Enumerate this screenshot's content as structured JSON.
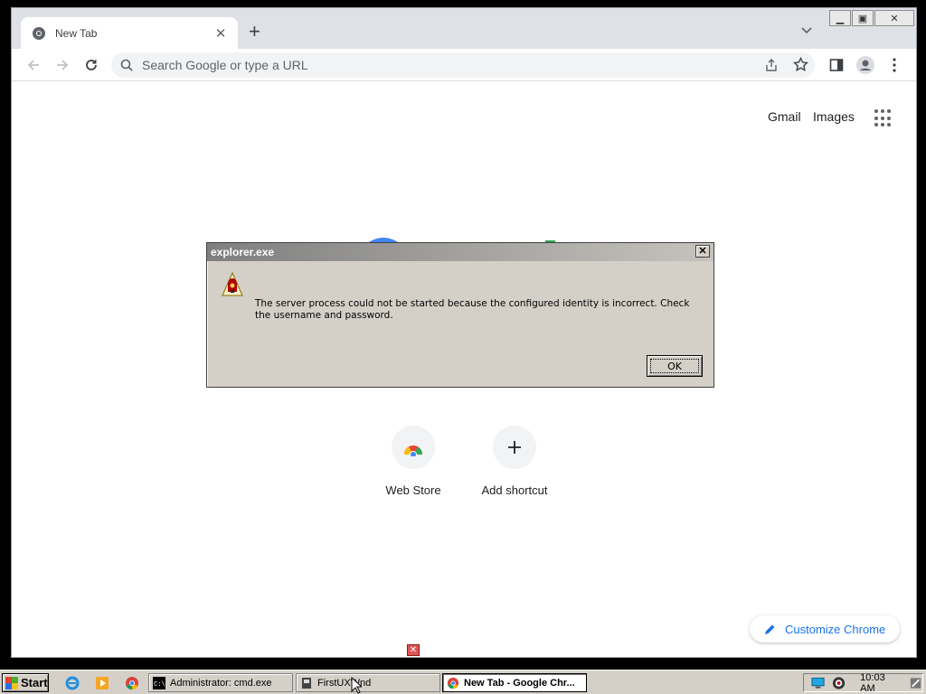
{
  "browser": {
    "tab_title": "New Tab",
    "address_placeholder": "Search Google or type a URL"
  },
  "ntp": {
    "links": [
      "Gmail",
      "Images"
    ],
    "shortcuts": [
      {
        "label": "Web Store",
        "icon": "chrome-web-store-icon"
      },
      {
        "label": "Add shortcut",
        "icon": "plus-icon"
      }
    ],
    "customize_label": "Customize Chrome"
  },
  "dialog": {
    "title": "explorer.exe",
    "message": "The server process could not be started because the configured identity is incorrect. Check the username and password.",
    "ok_label": "OK",
    "icon": "warning-icon"
  },
  "taskbar": {
    "start_label": "Start",
    "tasks": [
      {
        "label": "Administrator: cmd.exe",
        "icon": "cmd-icon",
        "active": false
      },
      {
        "label": "FirstUXWnd",
        "icon": "app-icon",
        "active": false
      },
      {
        "label": "New Tab - Google Chr...",
        "icon": "chrome-icon",
        "active": true
      }
    ],
    "clock": "10:03 AM"
  },
  "colors": {
    "accent": "#1a73e8",
    "dialog_bg": "#d4d0c8",
    "taskbar_bg": "#d4d0c8"
  }
}
